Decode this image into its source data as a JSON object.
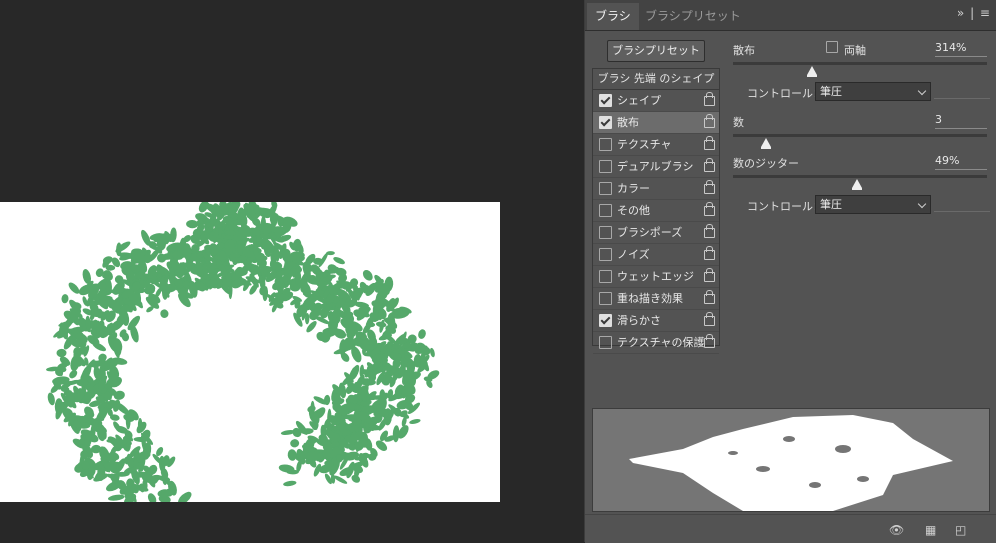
{
  "panel": {
    "tabs": [
      {
        "label": "ブラシ"
      },
      {
        "label": "ブラシプリセット"
      }
    ],
    "presets_button": "ブラシプリセット",
    "list_header": "ブラシ 先端 のシェイプ",
    "items": [
      {
        "label": "シェイプ",
        "checked": true
      },
      {
        "label": "散布",
        "checked": true,
        "selected": true
      },
      {
        "label": "テクスチャ",
        "checked": false
      },
      {
        "label": "デュアルブラシ",
        "checked": false
      },
      {
        "label": "カラー",
        "checked": false
      },
      {
        "label": "その他",
        "checked": false
      },
      {
        "label": "ブラシポーズ",
        "checked": false
      },
      {
        "label": "ノイズ",
        "checked": false
      },
      {
        "label": "ウェットエッジ",
        "checked": false
      },
      {
        "label": "重ね描き効果",
        "checked": false
      },
      {
        "label": "滑らかさ",
        "checked": true
      },
      {
        "label": "テクスチャの保護",
        "checked": false
      }
    ]
  },
  "scatter": {
    "label": "散布",
    "both_axes_label": "両軸",
    "both_axes_checked": false,
    "value": "314%",
    "level": 0.31,
    "control_label": "コントロール：",
    "control_value": "筆圧"
  },
  "count": {
    "label": "数",
    "value": "3",
    "level": 0.13
  },
  "count_jitter": {
    "label": "数のジッター",
    "value": "49%",
    "level": 0.49,
    "control_label": "コントロール：",
    "control_value": "筆圧"
  },
  "colors": {
    "brush_green": "#55a86a",
    "panel_bg": "#535353",
    "canvas_bg": "#ffffff"
  }
}
